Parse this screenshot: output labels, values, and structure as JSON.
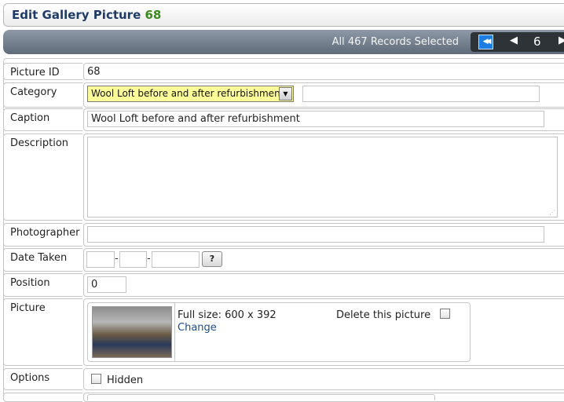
{
  "header": {
    "title": "Edit Gallery Picture",
    "record_id": "68"
  },
  "navigation": {
    "selection_text": "All 467 Records Selected",
    "page_number": "6"
  },
  "form": {
    "picture_id": {
      "label": "Picture ID",
      "value": "68"
    },
    "category": {
      "label": "Category",
      "selected": "Wool Loft before and after refurbishment",
      "extra_value": ""
    },
    "caption": {
      "label": "Caption",
      "value": "Wool Loft before and after refurbishment"
    },
    "description": {
      "label": "Description",
      "value": ""
    },
    "photographer": {
      "label": "Photographer",
      "value": ""
    },
    "date_taken": {
      "label": "Date Taken",
      "day": "",
      "month": "",
      "year": "",
      "help_label": "?",
      "separator": "-"
    },
    "position": {
      "label": "Position",
      "value": "0"
    },
    "picture": {
      "label": "Picture",
      "full_size_text": "Full size: 600 x 392",
      "change_label": "Change",
      "delete_label": "Delete this picture"
    },
    "options": {
      "label": "Options",
      "hidden_label": "Hidden"
    }
  }
}
